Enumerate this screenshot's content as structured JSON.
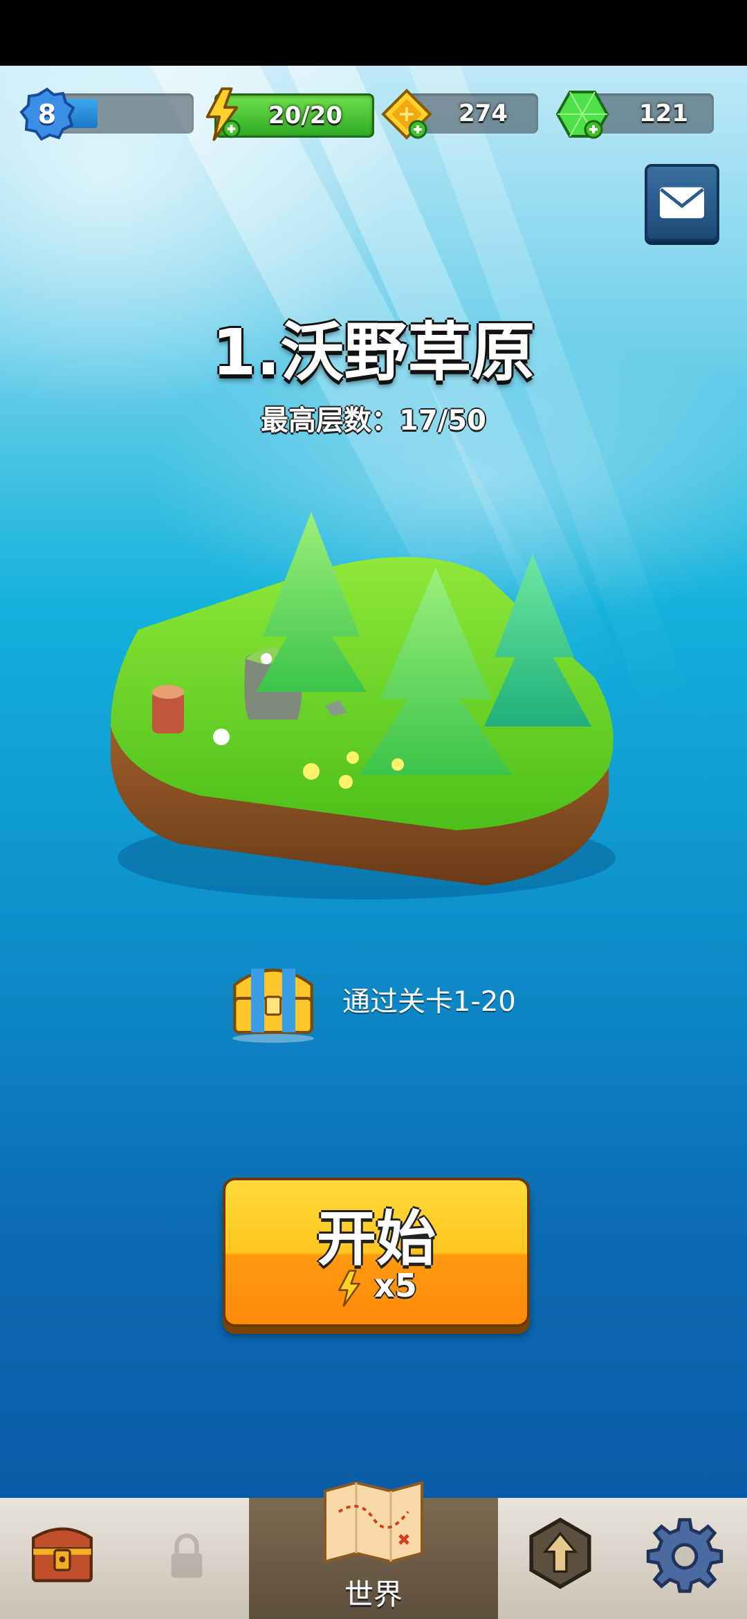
{
  "hud": {
    "level": "8",
    "level_progress": 0.3,
    "energy": "20/20",
    "coins": "274",
    "gems": "121",
    "energy_icon": "lightning-icon",
    "coin_icon": "coin-icon",
    "gem_icon": "gem-icon",
    "add_icon": "plus-icon"
  },
  "mail": {
    "icon": "envelope-icon"
  },
  "stage": {
    "title": "1.沃野草原",
    "record": "最高层数：17/50"
  },
  "reward": {
    "icon": "treasure-chest-icon",
    "text": "通过关卡1-20"
  },
  "start": {
    "label": "开始",
    "cost": "x5",
    "cost_icon": "lightning-icon"
  },
  "nav": {
    "tabs": [
      {
        "icon": "chest-icon",
        "label": "",
        "active": false
      },
      {
        "icon": "lock-icon",
        "label": "",
        "active": false
      },
      {
        "icon": "map-icon",
        "label": "世界",
        "active": true
      },
      {
        "icon": "upgrade-arrow-icon",
        "label": "",
        "active": false
      },
      {
        "icon": "gear-icon",
        "label": "",
        "active": false
      }
    ]
  },
  "colors": {
    "accent_yellow": "#ffc61f",
    "energy_green": "#2faa22",
    "ocean_blue": "#0c6bb2"
  }
}
